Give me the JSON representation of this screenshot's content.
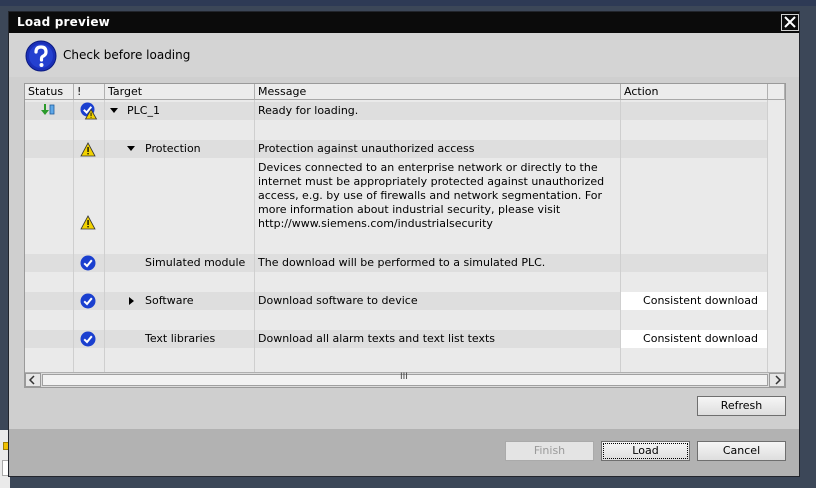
{
  "window": {
    "title": "Load preview"
  },
  "header": {
    "text": "Check before loading",
    "icon": "question-icon"
  },
  "columns": [
    "Status",
    "!",
    "Target",
    "Message",
    "Action"
  ],
  "rows": [
    {
      "target": "PLC_1",
      "message": "Ready for loading.",
      "action": ""
    },
    {
      "target": "Protection",
      "message": "Protection against unauthorized access",
      "action": ""
    },
    {
      "target": "",
      "message": "Devices connected to an enterprise network or directly to the internet must be appropriately protected against unauthorized access, e.g. by use of firewalls and network segmentation. For more information about industrial security, please visit http://www.siemens.com/industrialsecurity",
      "action": ""
    },
    {
      "target": "Simulated module",
      "message": "The download will be performed to a simulated PLC.",
      "action": ""
    },
    {
      "target": "Software",
      "message": "Download software to device",
      "action": "Consistent download"
    },
    {
      "target": "Text libraries",
      "message": "Download all alarm texts and text list texts",
      "action": "Consistent download"
    }
  ],
  "scrollbar": {
    "thumb_glyph": "III"
  },
  "buttons": {
    "refresh": "Refresh",
    "finish": "Finish",
    "load": "Load",
    "cancel": "Cancel"
  },
  "colors": {
    "check_blue": "#1a3fcf",
    "warning_yellow": "#f2d200",
    "titlebar": "#0b0b0b"
  }
}
